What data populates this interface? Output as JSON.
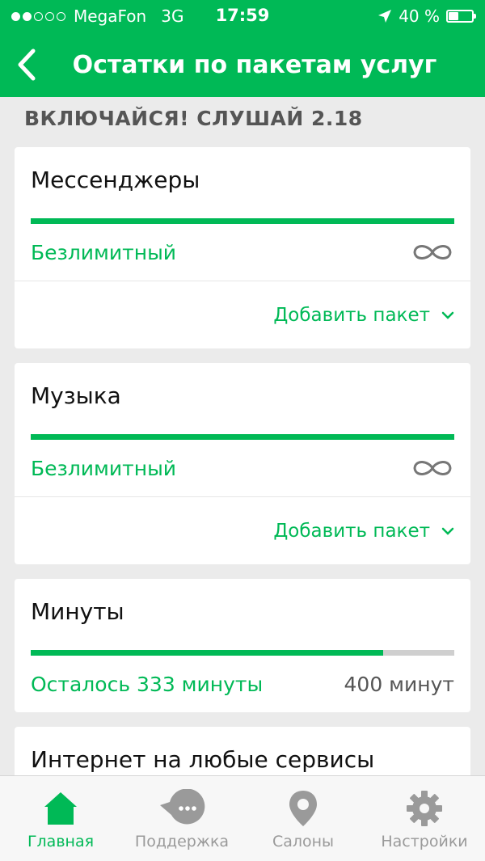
{
  "status": {
    "carrier": "MegaFon",
    "network": "3G",
    "time": "17:59",
    "battery": "40 %",
    "battery_level": 0.4,
    "signal_dots": 2
  },
  "nav": {
    "title": "Остатки по пакетам услуг"
  },
  "section": {
    "title": "ВКЛЮЧАЙСЯ! СЛУШАЙ 2.18"
  },
  "cards": [
    {
      "title": "Мессенджеры",
      "remaining": "Безлимитный",
      "progress": 1.0,
      "add_label": "Добавить пакет"
    },
    {
      "title": "Музыка",
      "remaining": "Безлимитный",
      "progress": 1.0,
      "add_label": "Добавить пакет"
    },
    {
      "title": "Минуты",
      "remaining": "Осталось 333 минуты",
      "total": "400 минут",
      "progress": 0.8325
    },
    {
      "title": "Интернет на любые сервисы"
    }
  ],
  "tabs": [
    {
      "label": "Главная",
      "icon": "home-icon"
    },
    {
      "label": "Поддержка",
      "icon": "chat-icon"
    },
    {
      "label": "Салоны",
      "icon": "location-pin-icon"
    },
    {
      "label": "Настройки",
      "icon": "gear-icon"
    }
  ],
  "colors": {
    "accent": "#00b956",
    "background": "#ebebeb",
    "inactive": "#9a9a9a"
  }
}
